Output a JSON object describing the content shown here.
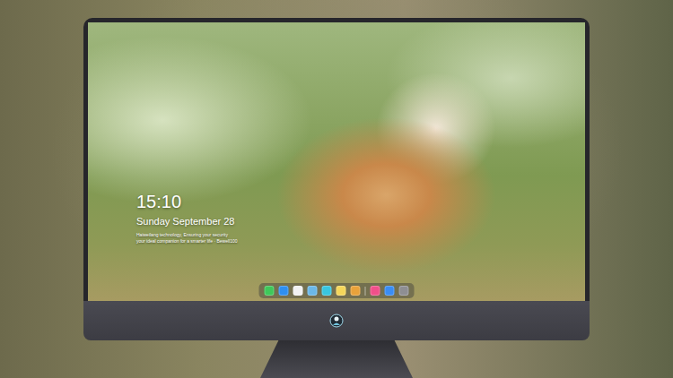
{
  "desktop": {
    "time": "15:10",
    "date": "Sunday September 28",
    "caption_lines": [
      "Haiweilang technology, Ensuring your security",
      "your ideal companion for a smarter life · Bewell100"
    ]
  },
  "dock": {
    "apps": [
      {
        "color": "#3fc85a"
      },
      {
        "color": "#2f8ff0"
      },
      {
        "color": "#f2f2f2"
      },
      {
        "color": "#6bb8e8"
      },
      {
        "color": "#39c6e0"
      },
      {
        "color": "#f5d65a"
      },
      {
        "color": "#e9a23b"
      }
    ],
    "recent": [
      {
        "color": "#f0508a"
      },
      {
        "color": "#3a8df5"
      },
      {
        "color": "#8e8e93"
      }
    ]
  }
}
